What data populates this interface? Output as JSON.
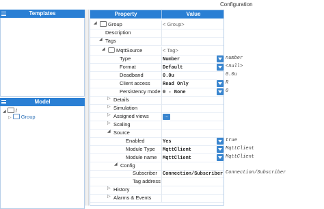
{
  "header": {
    "title": "Configuration"
  },
  "templates_panel": {
    "title": "Templates"
  },
  "model_panel": {
    "title": "Model",
    "tree": [
      {
        "label": "/",
        "expanded": true
      },
      {
        "label": "Group",
        "expanded": false
      }
    ]
  },
  "grid": {
    "columns": {
      "property": "Property",
      "value": "Value"
    },
    "rows": [
      {
        "label": "Group",
        "value": "< Group>",
        "hint": ""
      },
      {
        "label": "Description",
        "value": "",
        "hint": ""
      },
      {
        "label": "Tags",
        "value": "",
        "hint": ""
      },
      {
        "label": "MqttSource",
        "value": "< Tag>",
        "hint": ""
      },
      {
        "label": "Type",
        "value": "Number",
        "hint": "number"
      },
      {
        "label": "Format",
        "value": "Default",
        "hint": "<null>"
      },
      {
        "label": "Deadband",
        "value": "0.0u",
        "hint": "0.0u"
      },
      {
        "label": "Client access",
        "value": "Read Only",
        "hint": "R"
      },
      {
        "label": "Persistency mode",
        "value": "0 - None",
        "hint": "0"
      },
      {
        "label": "Details",
        "value": "",
        "hint": ""
      },
      {
        "label": "Simulation",
        "value": "",
        "hint": ""
      },
      {
        "label": "Assigned views",
        "value": "...",
        "hint": ""
      },
      {
        "label": "Scaling",
        "value": "",
        "hint": ""
      },
      {
        "label": "Source",
        "value": "",
        "hint": ""
      },
      {
        "label": "Enabled",
        "value": "Yes",
        "hint": "true"
      },
      {
        "label": "Module Type",
        "value": "MqttClient",
        "hint": "MqttClient"
      },
      {
        "label": "Module name",
        "value": "MqttClient",
        "hint": "MqttClient"
      },
      {
        "label": "Config",
        "value": "",
        "hint": ""
      },
      {
        "label": "Subscriber",
        "value": "Connection/Subscriber",
        "hint": "Connection/Subscriber"
      },
      {
        "label": "Tag address",
        "value": "",
        "hint": ""
      },
      {
        "label": "History",
        "value": "",
        "hint": ""
      },
      {
        "label": "Alarms & Events",
        "value": "",
        "hint": ""
      }
    ]
  },
  "colors": {
    "header_blue": "#2a7fd4",
    "button_blue": "#3a86cf"
  }
}
